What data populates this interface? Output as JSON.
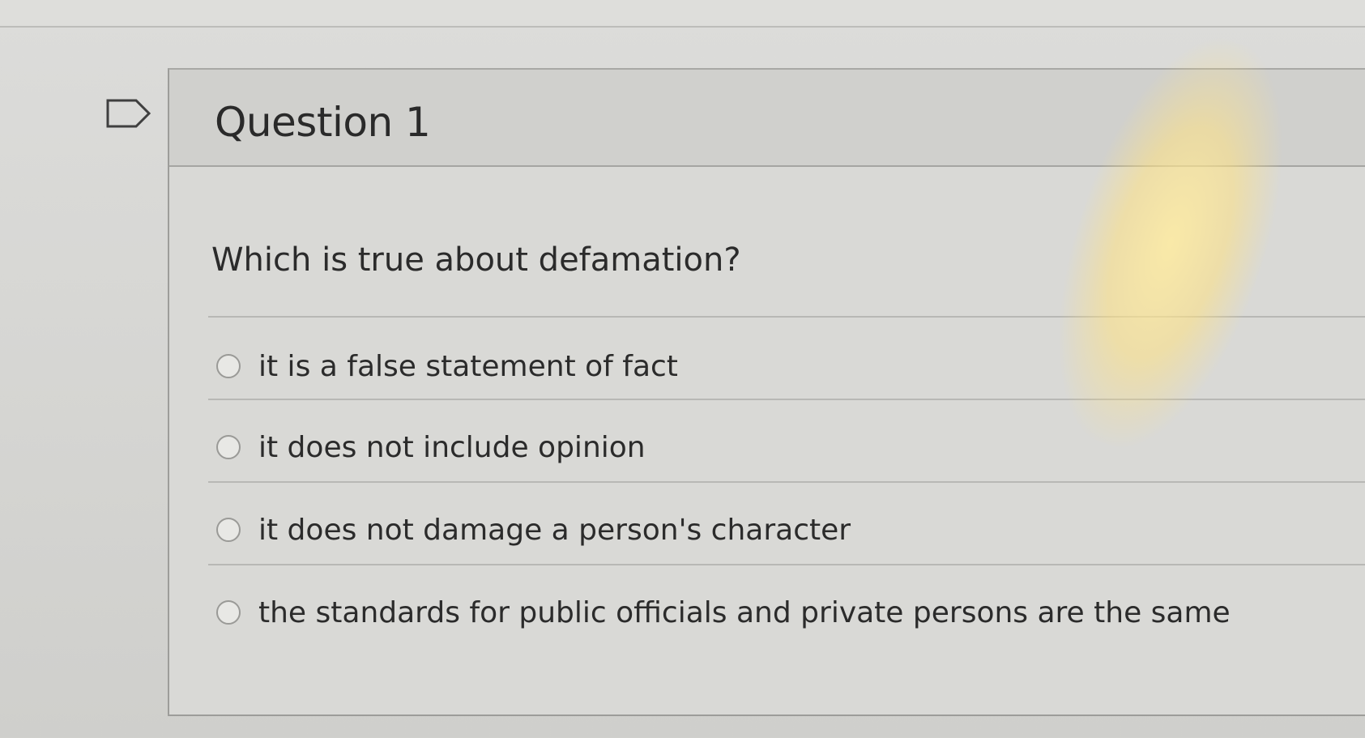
{
  "question": {
    "title": "Question 1",
    "prompt": "Which is true about defamation?",
    "answers": [
      {
        "label": "it is a false statement of fact",
        "selected": false
      },
      {
        "label": "it does not include opinion",
        "selected": false
      },
      {
        "label": "it does not damage a person's character",
        "selected": false
      },
      {
        "label": "the standards for public officials and private persons are the same",
        "selected": false
      }
    ]
  },
  "icons": {
    "flag": "flag-question-icon"
  },
  "colors": {
    "background": "#d9d9d6",
    "header": "#d0d0cd",
    "text": "#2b2b2b",
    "border": "#9d9d9a"
  }
}
